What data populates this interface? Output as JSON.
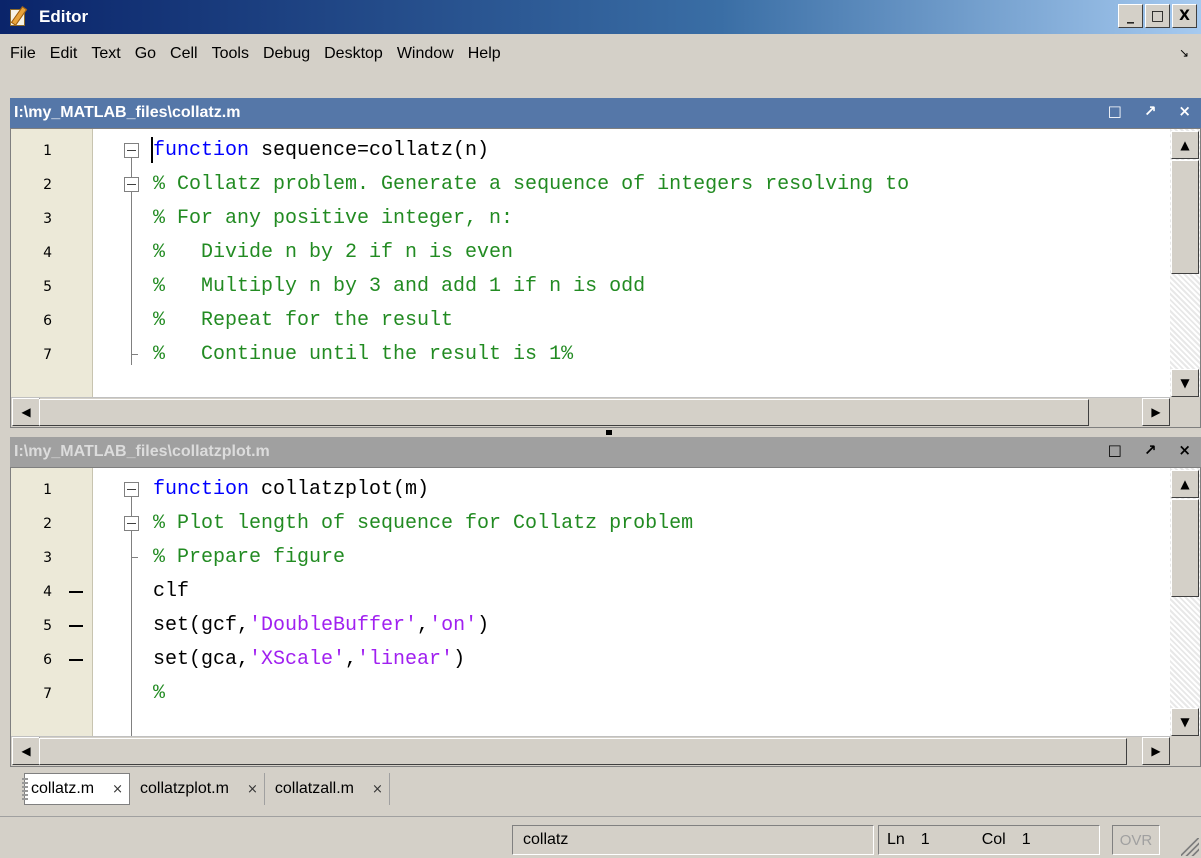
{
  "window": {
    "title": "Editor",
    "minimize": "_",
    "maximize": "□",
    "close": "X"
  },
  "menu": [
    "File",
    "Edit",
    "Text",
    "Go",
    "Cell",
    "Tools",
    "Debug",
    "Desktop",
    "Window",
    "Help"
  ],
  "menu_dock_icon": "↘",
  "pane_top": {
    "title": "I:\\my_MATLAB_files\\collatz.m",
    "lines": [
      {
        "n": "1",
        "code": "function sequence=collatz(n)"
      },
      {
        "n": "2",
        "code": "% Collatz problem. Generate a sequence of integers resolving to"
      },
      {
        "n": "3",
        "code": "% For any positive integer, n:"
      },
      {
        "n": "4",
        "code": "%   Divide n by 2 if n is even"
      },
      {
        "n": "5",
        "code": "%   Multiply n by 3 and add 1 if n is odd"
      },
      {
        "n": "6",
        "code": "%   Repeat for the result"
      },
      {
        "n": "7",
        "code": "%   Continue until the result is 1%"
      }
    ]
  },
  "pane_bottom": {
    "title": "I:\\my_MATLAB_files\\collatzplot.m",
    "lines": [
      {
        "n": "1",
        "code": "function collatzplot(m)"
      },
      {
        "n": "2",
        "code": "% Plot length of sequence for Collatz problem"
      },
      {
        "n": "3",
        "code": "% Prepare figure"
      },
      {
        "n": "4",
        "code": "clf"
      },
      {
        "n": "5",
        "code": "set(gcf,'DoubleBuffer','on')"
      },
      {
        "n": "6",
        "code": "set(gca,'XScale','linear')"
      },
      {
        "n": "7",
        "code": "%"
      }
    ]
  },
  "pane_controls": {
    "undock": "□",
    "arrow": "↗",
    "close": "×"
  },
  "tabs": [
    {
      "label": "collatz.m",
      "close": "×"
    },
    {
      "label": "collatzplot.m",
      "close": "×"
    },
    {
      "label": "collatzall.m",
      "close": "×"
    }
  ],
  "status": {
    "function": "collatz",
    "ln_label": "Ln",
    "ln_value": "1",
    "col_label": "Col",
    "col_value": "1",
    "ovr": "OVR"
  },
  "colors": {
    "keyword": "#0000ff",
    "comment": "#228b22",
    "string": "#a020f0",
    "active_title": "#5577a8",
    "inactive_title": "#a0a0a0"
  }
}
